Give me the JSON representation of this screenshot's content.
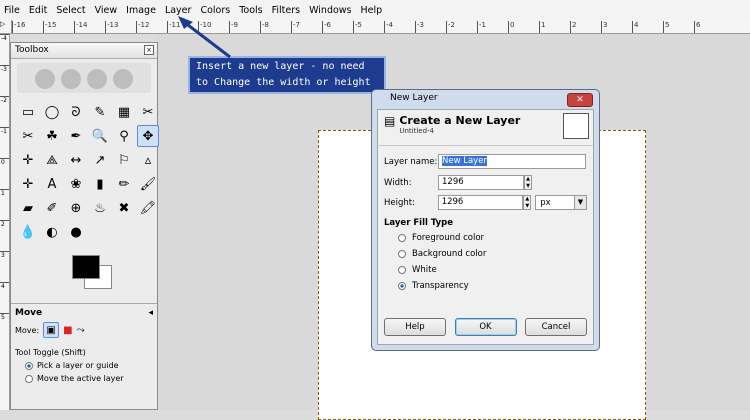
{
  "menu": [
    "File",
    "Edit",
    "Select",
    "View",
    "Image",
    "Layer",
    "Colors",
    "Tools",
    "Filters",
    "Windows",
    "Help"
  ],
  "ruler_top": [
    "-16",
    "-15",
    "-14",
    "-13",
    "-12",
    "-11",
    "-10",
    "-9",
    "-8",
    "-7",
    "-6",
    "-5",
    "-4",
    "-3",
    "-2",
    "-1",
    "0",
    "1",
    "2",
    "3",
    "4",
    "5",
    "6"
  ],
  "ruler_left": [
    "-4",
    "-3",
    "-2",
    "-1",
    "0",
    "1",
    "2",
    "3",
    "4",
    "5"
  ],
  "toolbox": {
    "title": "Toolbox",
    "tools": [
      "▭",
      "◯",
      "ᘐ",
      "✎",
      "▦",
      "✂",
      "✂",
      "☘",
      "✒",
      "🔍",
      "⚲",
      "✥",
      "✛",
      "⟁",
      "↔",
      "↗",
      "⚐",
      "▵",
      "✛",
      "A",
      "❀",
      "▮",
      "✏",
      "🖌",
      "▰",
      "✐",
      "⊕",
      "♨",
      "✖",
      "🖍",
      "💧",
      "◐",
      "●",
      "",
      "",
      ""
    ],
    "tool_names": [
      "rect-select-icon",
      "ellipse-select-icon",
      "free-select-icon",
      "fuzzy-select-icon",
      "color-select-icon",
      "scissors-icon",
      "foreground-select-icon",
      "paths-icon",
      "color-picker-icon",
      "zoom-icon",
      "measure-icon",
      "move-icon",
      "align-icon",
      "transform-icon",
      "flip-icon",
      "shear-icon",
      "perspective-icon",
      "cage-icon",
      "crop-icon",
      "text-icon",
      "bucket-fill-icon",
      "blend-icon",
      "pencil-icon",
      "paintbrush-icon",
      "eraser-icon",
      "airbrush-icon",
      "ink-icon",
      "clone-icon",
      "heal-icon",
      "perspective-clone-icon",
      "blur-icon",
      "smudge-icon",
      "dodge-icon",
      "empty-1",
      "empty-2",
      "empty-3"
    ],
    "options_title": "Move",
    "move_label": "Move:",
    "tool_toggle": "Tool Toggle  (Shift)",
    "option1": "Pick a layer or guide",
    "option2": "Move the active layer"
  },
  "callout": {
    "line1": "Insert a new layer - no need",
    "line2": "to Change the width or height"
  },
  "dialog": {
    "title": "New Layer",
    "heading": "Create a New Layer",
    "subheading": "Untitled-4",
    "layer_name_label": "Layer name:",
    "layer_name_value": "New Layer",
    "width_label": "Width:",
    "width_value": "1296",
    "height_label": "Height:",
    "height_value": "1296",
    "unit": "px",
    "fill_type_label": "Layer Fill Type",
    "fill_options": [
      "Foreground color",
      "Background color",
      "White",
      "Transparency"
    ],
    "selected_fill": "Transparency",
    "help": "Help",
    "ok": "OK",
    "cancel": "Cancel"
  }
}
